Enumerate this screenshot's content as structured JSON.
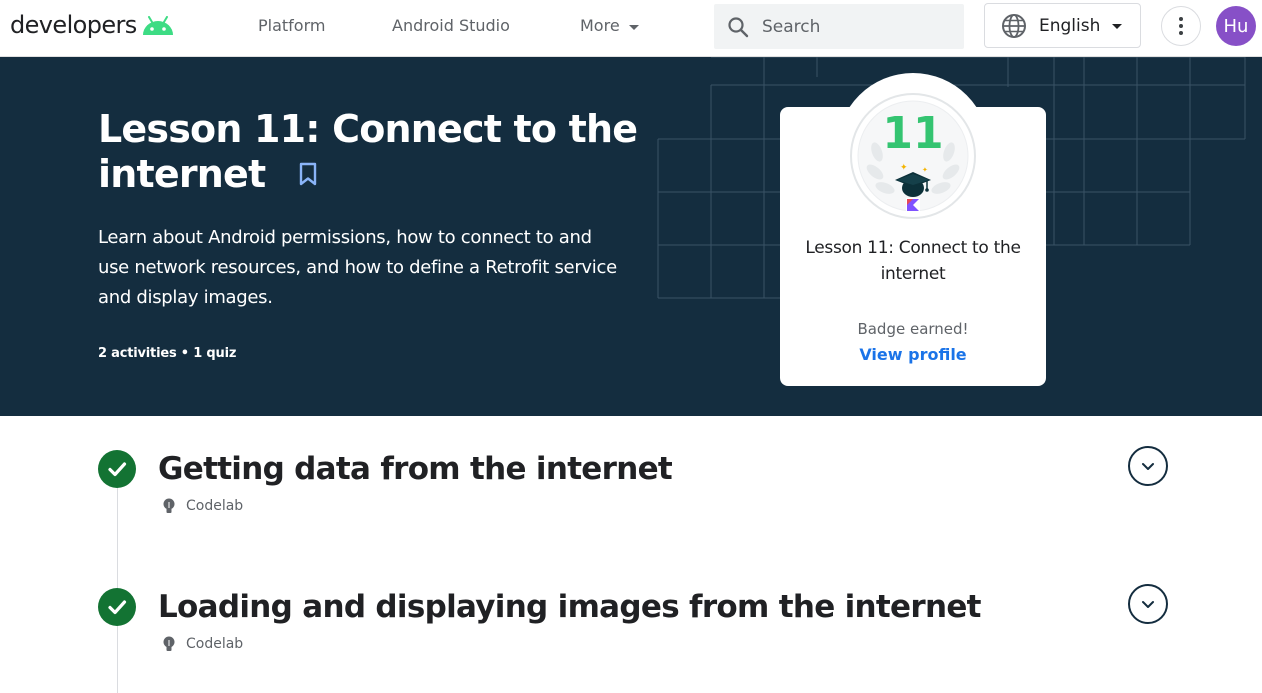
{
  "header": {
    "logo_text": "developers",
    "nav": [
      {
        "label": "Platform"
      },
      {
        "label": "Android Studio"
      },
      {
        "label": "More"
      }
    ],
    "search": {
      "placeholder": "Search",
      "value": ""
    },
    "language": {
      "label": "English"
    },
    "avatar": {
      "initials": "Hu",
      "color": "#8750c7"
    }
  },
  "hero": {
    "title": "Lesson 11: Connect to the internet",
    "description": "Learn about Android permissions, how to connect to and use network resources, and how to define a Retrofit service and display images.",
    "meta": "2 activities • 1 quiz",
    "background_color": "#142d3f"
  },
  "badge": {
    "number": "11",
    "title": "Lesson 11: Connect to the internet",
    "status": "Badge earned!",
    "link_label": "View profile"
  },
  "activities": [
    {
      "title": "Getting data from the internet",
      "type": "Codelab",
      "completed": true
    },
    {
      "title": "Loading and displaying images from the internet",
      "type": "Codelab",
      "completed": true
    }
  ],
  "colors": {
    "accent": "#1a73e8",
    "complete": "#137333",
    "android_green": "#3ddc84",
    "badge_number": "#34c471"
  },
  "icons": [
    "android-logo-icon",
    "search-icon",
    "globe-icon",
    "more-vert-icon",
    "bookmark-icon",
    "check-icon",
    "lightbulb-icon",
    "chevron-down-icon"
  ]
}
